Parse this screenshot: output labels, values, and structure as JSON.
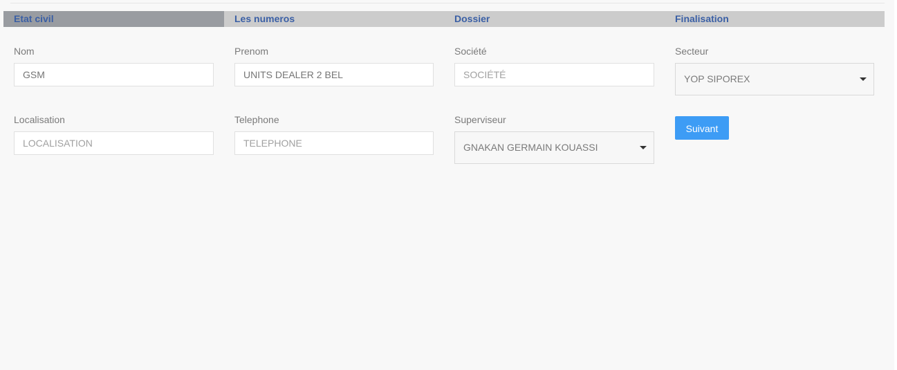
{
  "steps": [
    {
      "label": "Etat civil",
      "active": true
    },
    {
      "label": "Les numeros",
      "active": false
    },
    {
      "label": "Dossier",
      "active": false
    },
    {
      "label": "Finalisation",
      "active": false
    }
  ],
  "form": {
    "nom": {
      "label": "Nom",
      "value": "GSM"
    },
    "prenom": {
      "label": "Prenom",
      "value": "UNITS DEALER 2 BEL"
    },
    "societe": {
      "label": "Société",
      "placeholder": "SOCIÉTÉ"
    },
    "secteur": {
      "label": "Secteur",
      "selected": "YOP SIPOREX"
    },
    "localisation": {
      "label": "Localisation",
      "placeholder": "LOCALISATION"
    },
    "telephone": {
      "label": "Telephone",
      "placeholder": "TELEPHONE"
    },
    "superviseur": {
      "label": "Superviseur",
      "selected": "GNAKAN GERMAIN KOUASSI"
    }
  },
  "buttons": {
    "next_label": "Suivant"
  },
  "colors": {
    "step_text": "#3a5fa5",
    "active_step_bg": "#999ca1",
    "steps_bar_bg": "#cccccc",
    "button_bg": "#3d9cf5"
  }
}
